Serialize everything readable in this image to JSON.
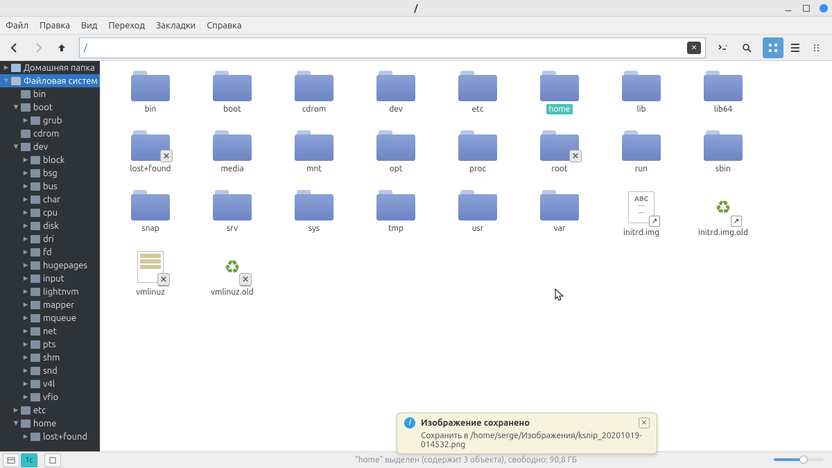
{
  "window": {
    "title": "/"
  },
  "menu": {
    "file": "Файл",
    "edit": "Правка",
    "view": "Вид",
    "go": "Переход",
    "bookmarks": "Закладки",
    "help": "Справка"
  },
  "toolbar": {
    "path_value": "/"
  },
  "sidebar": {
    "home_label": "Домашняя папка",
    "fs_label": "Файловая систем",
    "tree": [
      {
        "label": "bin",
        "depth": 1,
        "exp": false,
        "children": false
      },
      {
        "label": "boot",
        "depth": 1,
        "exp": true,
        "children": true
      },
      {
        "label": "grub",
        "depth": 2,
        "exp": false,
        "children": true
      },
      {
        "label": "cdrom",
        "depth": 1,
        "exp": false,
        "children": false
      },
      {
        "label": "dev",
        "depth": 1,
        "exp": true,
        "children": true
      },
      {
        "label": "block",
        "depth": 2,
        "exp": false,
        "children": true
      },
      {
        "label": "bsg",
        "depth": 2,
        "exp": false,
        "children": true
      },
      {
        "label": "bus",
        "depth": 2,
        "exp": false,
        "children": true
      },
      {
        "label": "char",
        "depth": 2,
        "exp": false,
        "children": true
      },
      {
        "label": "cpu",
        "depth": 2,
        "exp": false,
        "children": true
      },
      {
        "label": "disk",
        "depth": 2,
        "exp": false,
        "children": true
      },
      {
        "label": "dri",
        "depth": 2,
        "exp": false,
        "children": true
      },
      {
        "label": "fd",
        "depth": 2,
        "exp": false,
        "children": true
      },
      {
        "label": "hugepages",
        "depth": 2,
        "exp": false,
        "children": true
      },
      {
        "label": "input",
        "depth": 2,
        "exp": false,
        "children": true
      },
      {
        "label": "lightnvm",
        "depth": 2,
        "exp": false,
        "children": true
      },
      {
        "label": "mapper",
        "depth": 2,
        "exp": false,
        "children": true
      },
      {
        "label": "mqueue",
        "depth": 2,
        "exp": false,
        "children": true
      },
      {
        "label": "net",
        "depth": 2,
        "exp": false,
        "children": true
      },
      {
        "label": "pts",
        "depth": 2,
        "exp": false,
        "children": true
      },
      {
        "label": "shm",
        "depth": 2,
        "exp": false,
        "children": true
      },
      {
        "label": "snd",
        "depth": 2,
        "exp": false,
        "children": true
      },
      {
        "label": "v4l",
        "depth": 2,
        "exp": false,
        "children": true
      },
      {
        "label": "vfio",
        "depth": 2,
        "exp": false,
        "children": true
      },
      {
        "label": "etc",
        "depth": 1,
        "exp": false,
        "children": true
      },
      {
        "label": "home",
        "depth": 1,
        "exp": true,
        "children": true
      },
      {
        "label": "lost+found",
        "depth": 2,
        "exp": false,
        "children": true
      }
    ]
  },
  "files": [
    {
      "name": "bin",
      "type": "folder"
    },
    {
      "name": "boot",
      "type": "folder"
    },
    {
      "name": "cdrom",
      "type": "folder"
    },
    {
      "name": "dev",
      "type": "folder"
    },
    {
      "name": "etc",
      "type": "folder"
    },
    {
      "name": "home",
      "type": "folder",
      "selected": true
    },
    {
      "name": "lib",
      "type": "folder"
    },
    {
      "name": "lib64",
      "type": "folder"
    },
    {
      "name": "lost+found",
      "type": "folder",
      "locked": true
    },
    {
      "name": "media",
      "type": "folder"
    },
    {
      "name": "mnt",
      "type": "folder"
    },
    {
      "name": "opt",
      "type": "folder"
    },
    {
      "name": "proc",
      "type": "folder"
    },
    {
      "name": "root",
      "type": "folder",
      "locked": true
    },
    {
      "name": "run",
      "type": "folder"
    },
    {
      "name": "sbin",
      "type": "folder"
    },
    {
      "name": "snap",
      "type": "folder"
    },
    {
      "name": "srv",
      "type": "folder"
    },
    {
      "name": "sys",
      "type": "folder"
    },
    {
      "name": "tmp",
      "type": "folder"
    },
    {
      "name": "usr",
      "type": "folder"
    },
    {
      "name": "var",
      "type": "folder"
    },
    {
      "name": "initrd.img",
      "type": "textlink"
    },
    {
      "name": "initrd.img.old",
      "type": "recyclelink"
    },
    {
      "name": "vmlinuz",
      "type": "binlink",
      "locked": true
    },
    {
      "name": "vmlinuz.old",
      "type": "recyclelink",
      "locked": true
    }
  ],
  "status": {
    "text": "\"home\" выделен (содержит 3 объекта), свободно: 90,8 ГБ"
  },
  "notification": {
    "title": "Изображение сохранено",
    "body": "Сохранить в /home/serge/Изображения/ksnip_20201019-014532.png"
  }
}
